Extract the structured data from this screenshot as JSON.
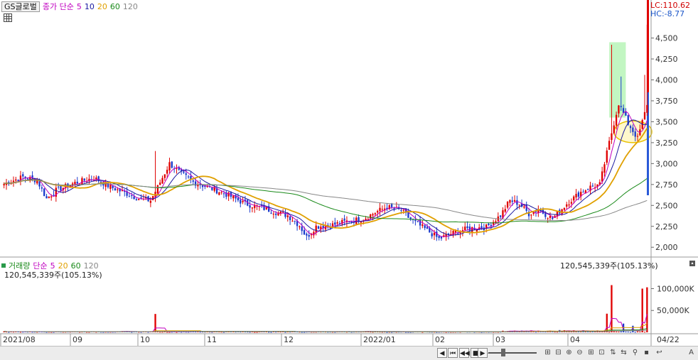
{
  "header": {
    "stock_name": "GS글로벌",
    "price_ma_title": "종가 단순",
    "ma_periods": [
      "5",
      "10",
      "20",
      "60",
      "120"
    ],
    "ma_colors": [
      "#c000c0",
      "#1a1aa0",
      "#e0a000",
      "#1a8a1a",
      "#888888"
    ],
    "grid_icon": "table-icon"
  },
  "volume_header": {
    "title": "거래량",
    "ma_title": "단순",
    "ma_periods": [
      "5",
      "20",
      "60",
      "120"
    ],
    "ma_colors": [
      "#c000c0",
      "#e0a000",
      "#1a8a1a",
      "#888888"
    ],
    "current_value": "120,545,339주(105.13%)",
    "right_value": "120,545,339주(105.13%)"
  },
  "right_panel": {
    "lc": "LC:110.62",
    "hc": "HC:-8.77"
  },
  "chart_data": [
    {
      "type": "candlestick",
      "title": "GS글로벌",
      "price_axis": [
        "4,500",
        "4,250",
        "4,000",
        "3,750",
        "3,500",
        "3,250",
        "3,000",
        "2,750",
        "2,500",
        "2,250",
        "2,000"
      ],
      "ylim": [
        1900,
        4700
      ],
      "x_labels": [
        "2021/08",
        "09",
        "10",
        "11",
        "12",
        "2022/01",
        "02",
        "03",
        "04",
        "04/22"
      ],
      "anchors": [
        [
          0,
          2760
        ],
        [
          8,
          2840
        ],
        [
          14,
          2800
        ],
        [
          18,
          2580
        ],
        [
          22,
          2680
        ],
        [
          30,
          2770
        ],
        [
          38,
          2830
        ],
        [
          45,
          2720
        ],
        [
          52,
          2640
        ],
        [
          58,
          2570
        ],
        [
          62,
          2560
        ],
        [
          65,
          2720
        ],
        [
          70,
          3000
        ],
        [
          74,
          2900
        ],
        [
          80,
          2780
        ],
        [
          88,
          2700
        ],
        [
          95,
          2620
        ],
        [
          102,
          2520
        ],
        [
          108,
          2480
        ],
        [
          115,
          2420
        ],
        [
          120,
          2380
        ],
        [
          125,
          2260
        ],
        [
          128,
          2120
        ],
        [
          132,
          2250
        ],
        [
          138,
          2260
        ],
        [
          145,
          2310
        ],
        [
          152,
          2340
        ],
        [
          158,
          2430
        ],
        [
          162,
          2480
        ],
        [
          168,
          2440
        ],
        [
          172,
          2330
        ],
        [
          178,
          2220
        ],
        [
          184,
          2100
        ],
        [
          188,
          2150
        ],
        [
          193,
          2200
        ],
        [
          198,
          2230
        ],
        [
          204,
          2240
        ],
        [
          210,
          2380
        ],
        [
          214,
          2560
        ],
        [
          218,
          2520
        ],
        [
          222,
          2400
        ],
        [
          226,
          2450
        ],
        [
          232,
          2340
        ],
        [
          238,
          2520
        ],
        [
          244,
          2660
        ],
        [
          248,
          2720
        ],
        [
          252,
          2750
        ],
        [
          256,
          3250
        ],
        [
          260,
          3720
        ],
        [
          264,
          3480
        ],
        [
          268,
          3300
        ],
        [
          272,
          3700
        ]
      ],
      "price_ma": [
        {
          "name": "5",
          "color": "#c000c0"
        },
        {
          "name": "10",
          "color": "#1a1aa0"
        },
        {
          "name": "20",
          "color": "#e0a000"
        },
        {
          "name": "60",
          "color": "#1a8a1a"
        },
        {
          "name": "120",
          "color": "#888888"
        }
      ],
      "highlights": [
        {
          "type": "rect",
          "color": "#90ee90",
          "from_bar": 256,
          "to_bar": 263,
          "price_from": 3550,
          "price_to": 4450
        },
        {
          "type": "ellipse",
          "color": "#e8c000",
          "fill": "#fff3a0",
          "center_bar": 266,
          "center_price": 3380,
          "rx_bars": 5,
          "ry_price": 130
        }
      ]
    },
    {
      "type": "bar",
      "title": "거래량",
      "volume_axis": [
        "100,000K",
        "50,000K"
      ],
      "ylim": [
        0,
        130000
      ],
      "spikes": [
        [
          64,
          42000
        ],
        [
          255,
          40000
        ],
        [
          257,
          108000
        ],
        [
          262,
          20000
        ],
        [
          266,
          15000
        ],
        [
          270,
          100000
        ],
        [
          272,
          103000
        ]
      ],
      "volume_ma": [
        {
          "name": "5",
          "color": "#c000c0"
        },
        {
          "name": "20",
          "color": "#e0a000"
        },
        {
          "name": "60",
          "color": "#1a8a1a"
        },
        {
          "name": "120",
          "color": "#888888"
        }
      ]
    }
  ],
  "navigation": {
    "buttons": [
      "◀",
      "⏮",
      "◀◀",
      "■",
      "▶▶",
      "▶"
    ],
    "tools": [
      "⊞",
      "⊟",
      "⊕",
      "⊖",
      "⊞",
      "⊡",
      "⇅",
      "⇆",
      "⚲",
      "▪",
      "↩",
      "A"
    ]
  }
}
